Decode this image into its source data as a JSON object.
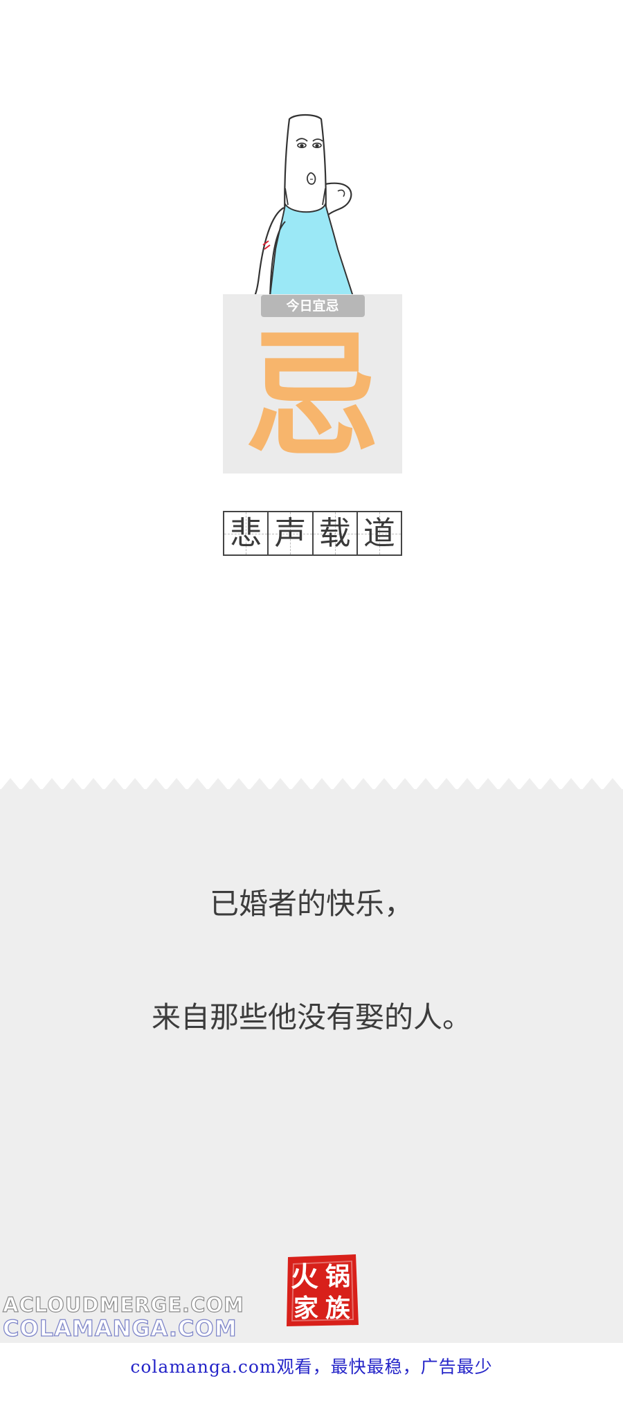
{
  "card": {
    "tag": "今日宜忌",
    "glyph": "忌"
  },
  "idiom": {
    "chars": [
      "悲",
      "声",
      "载",
      "道"
    ]
  },
  "quote": {
    "line1": "已婚者的快乐，",
    "line2": "来自那些他没有娶的人。"
  },
  "seal": {
    "text": "火锅家族",
    "color": "#d8201a"
  },
  "watermark": {
    "line1": "ACLOUDMERGE.COM",
    "line2": "COLAMANGA.COM"
  },
  "footer": {
    "text": "colamanga.com观看，最快最稳，广告最少"
  },
  "colors": {
    "accent_orange": "#f7b56c",
    "tank_top": "#9be8f6",
    "panel_grey": "#eeeeee",
    "footer_link": "#2424c8"
  }
}
